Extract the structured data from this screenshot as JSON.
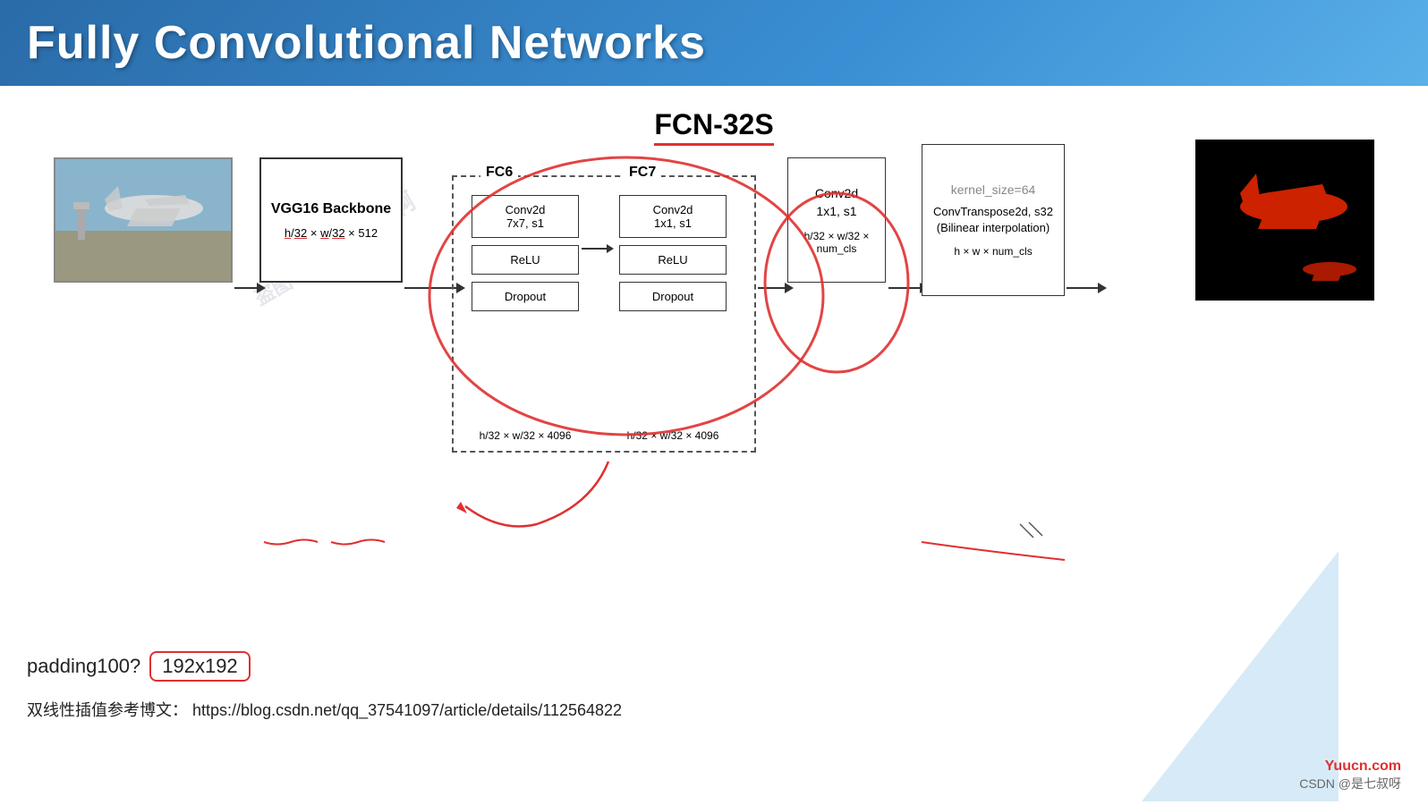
{
  "header": {
    "title": "Fully Convolutional Networks"
  },
  "diagram": {
    "fcn_label": "FCN-32S",
    "vgg": {
      "label": "VGG16 Backbone",
      "dim": "h/32 × w/32 × 512"
    },
    "fc6": {
      "label": "FC6",
      "conv": "Conv2d\n7x7, s1",
      "relu": "ReLU",
      "dropout": "Dropout",
      "dim": "h/32 × w/32 × 4096"
    },
    "fc7": {
      "label": "FC7",
      "conv": "Conv2d\n1x1, s1",
      "relu": "ReLU",
      "dropout": "Dropout",
      "dim": "h/32 × w/32 × 4096"
    },
    "conv_after": {
      "label": "Conv2d\n1x1, s1",
      "dim": "h/32 × w/32 × num_cls"
    },
    "conv_transpose": {
      "kernel": "kernel_size=64",
      "label": "ConvTranspose2d, s32\n(Bilinear interpolation)",
      "dim": "h × w × num_cls"
    }
  },
  "bottom": {
    "padding_label": "padding100?",
    "padding_value": "192x192",
    "reference_label": "双线性插值参考博文：",
    "reference_url": "https://blog.csdn.net/qq_37541097/article/details/112564822"
  },
  "watermark": {
    "yuucn": "Yuucn.com",
    "csdn": "CSDN @是七叔呀"
  }
}
